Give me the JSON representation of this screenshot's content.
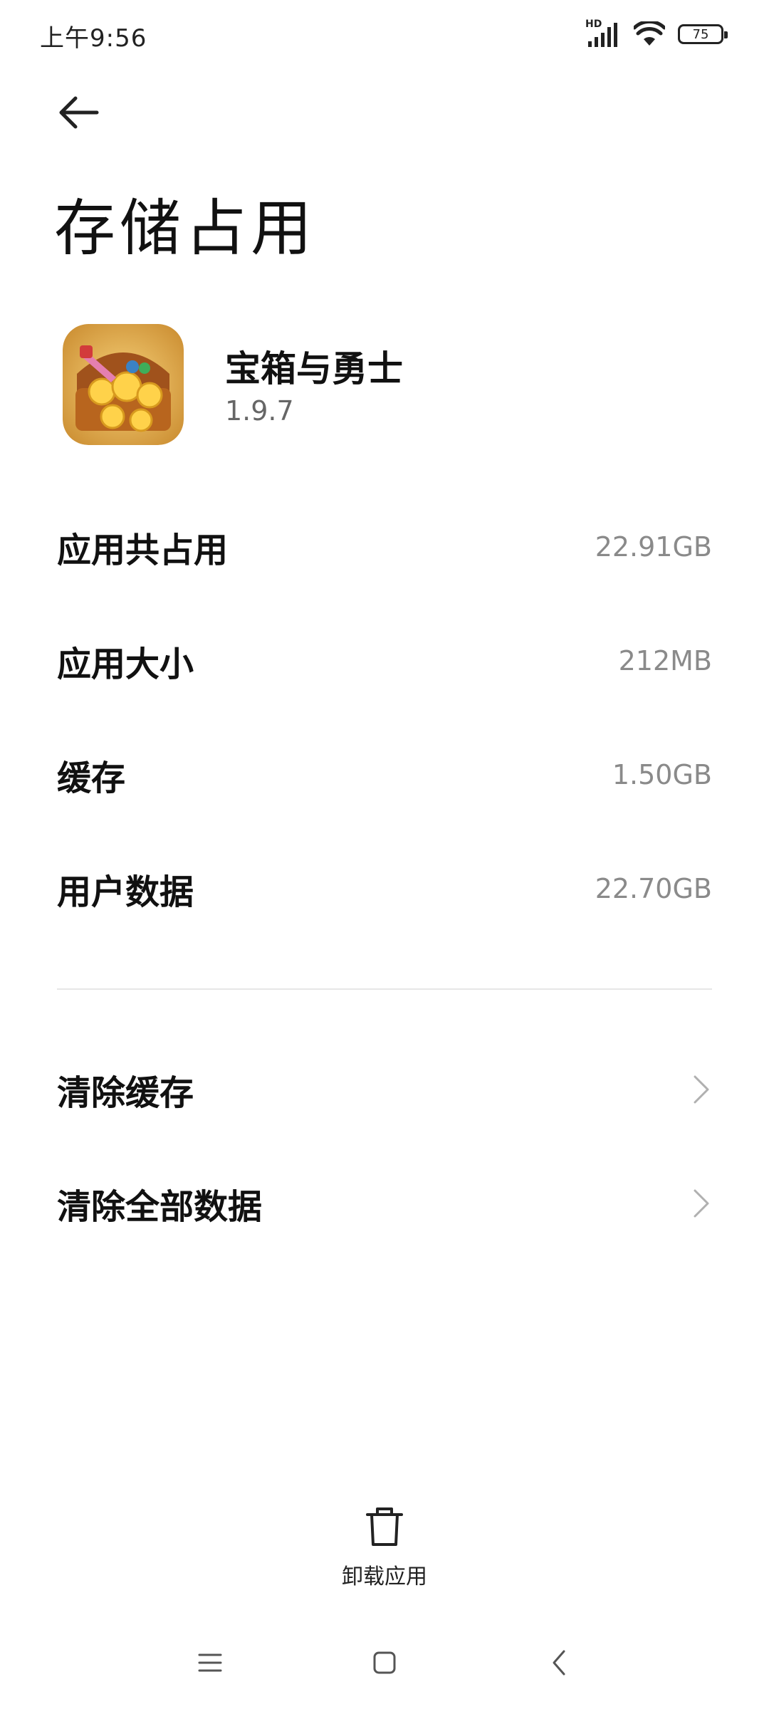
{
  "status_bar": {
    "time": "上午9:56",
    "network_label": "HD",
    "battery": "75",
    "icons": [
      "signal-icon",
      "wifi-icon",
      "battery-icon"
    ]
  },
  "header": {
    "back_icon": "back-arrow-icon",
    "title": "存储占用"
  },
  "app": {
    "name": "宝箱与勇士",
    "version": "1.9.7",
    "icon": "treasure-chest-app-icon"
  },
  "storage": [
    {
      "label": "应用共占用",
      "value": "22.91GB"
    },
    {
      "label": "应用大小",
      "value": "212MB"
    },
    {
      "label": "缓存",
      "value": "1.50GB"
    },
    {
      "label": "用户数据",
      "value": "22.70GB"
    }
  ],
  "actions": [
    {
      "label": "清除缓存",
      "icon": "chevron-right-icon"
    },
    {
      "label": "清除全部数据",
      "icon": "chevron-right-icon"
    }
  ],
  "bottom": {
    "uninstall_label": "卸载应用",
    "uninstall_icon": "trash-icon"
  },
  "nav_bar": {
    "icons": [
      "menu-icon",
      "home-icon",
      "back-icon"
    ]
  }
}
